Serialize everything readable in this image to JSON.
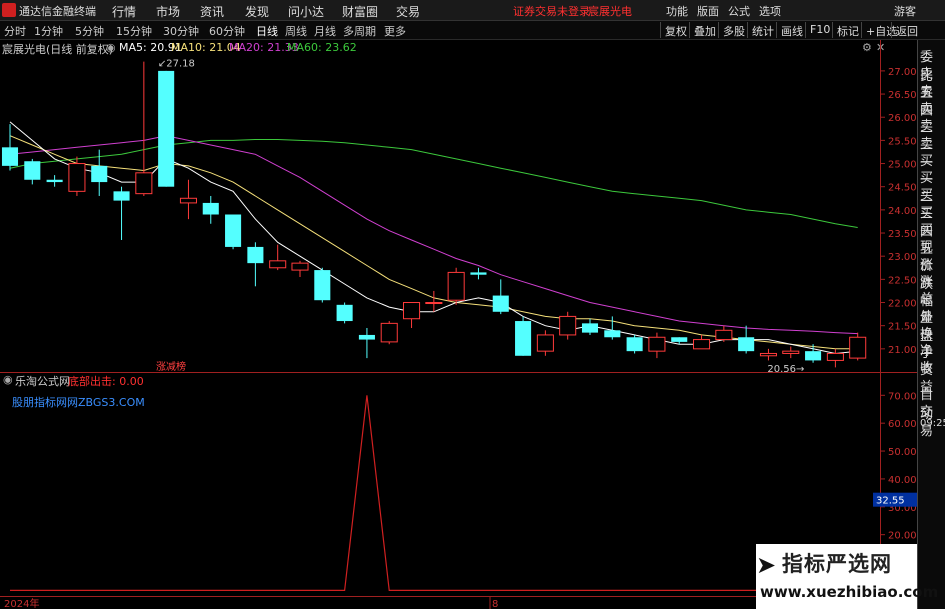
{
  "titlebar": {
    "app_title": "通达信金融终端",
    "menu": [
      "行情",
      "市场",
      "资讯",
      "发现",
      "问小达",
      "财富圈",
      "交易"
    ],
    "notice": "证券交易未登录",
    "stock_name": "宸展光电",
    "right_menu": [
      "功能",
      "版面",
      "公式",
      "选项"
    ],
    "guest": "游客"
  },
  "toolbar": {
    "periods": [
      "分时",
      "1分钟",
      "5分钟",
      "15分钟",
      "30分钟",
      "60分钟",
      "日线",
      "周线",
      "月线",
      "多周期",
      "更多"
    ],
    "active_period": "日线",
    "buttons": [
      "复权",
      "叠加",
      "多股",
      "统计",
      "画线",
      "F10",
      "标记",
      "+自选",
      "返回"
    ]
  },
  "legend": {
    "stock": "宸展光电(日线 前复权)",
    "ma5": "MA5: 20.91",
    "ma10": "MA10: 21.04",
    "ma20": "MA20: 21.33",
    "ma60": "MA60: 23.62"
  },
  "colors": {
    "up": "#ff3b3b",
    "down": "#54ffff",
    "ma5": "#ffffff",
    "ma10": "#f5e07a",
    "ma20": "#d040d0",
    "ma60": "#3cc83c",
    "indicator": "#d02020"
  },
  "price_axis": [
    "27.00",
    "26.50",
    "26.00",
    "25.50",
    "25.00",
    "24.50",
    "24.00",
    "23.50",
    "23.00",
    "22.50",
    "22.00",
    "21.50",
    "21.00"
  ],
  "annotations": {
    "high": "27.18",
    "low": "20.56",
    "tag": "涨减榜"
  },
  "candles": [
    {
      "o": 25.35,
      "c": 24.95,
      "h": 25.85,
      "l": 24.85
    },
    {
      "o": 25.05,
      "c": 24.65,
      "h": 25.1,
      "l": 24.55
    },
    {
      "o": 24.65,
      "c": 24.6,
      "h": 24.75,
      "l": 24.5
    },
    {
      "o": 24.4,
      "c": 25.0,
      "h": 25.15,
      "l": 24.3
    },
    {
      "o": 24.95,
      "c": 24.6,
      "h": 25.3,
      "l": 24.3
    },
    {
      "o": 24.4,
      "c": 24.2,
      "h": 24.5,
      "l": 23.35
    },
    {
      "o": 24.35,
      "c": 24.8,
      "h": 27.2,
      "l": 24.3
    },
    {
      "o": 27.0,
      "c": 24.5,
      "h": 27.0,
      "l": 24.5
    },
    {
      "o": 24.15,
      "c": 24.25,
      "h": 24.65,
      "l": 23.8
    },
    {
      "o": 24.15,
      "c": 23.9,
      "h": 24.3,
      "l": 23.7
    },
    {
      "o": 23.9,
      "c": 23.2,
      "h": 23.9,
      "l": 23.15
    },
    {
      "o": 23.2,
      "c": 22.85,
      "h": 23.3,
      "l": 22.35
    },
    {
      "o": 22.75,
      "c": 22.9,
      "h": 23.25,
      "l": 22.7
    },
    {
      "o": 22.7,
      "c": 22.85,
      "h": 22.9,
      "l": 22.55
    },
    {
      "o": 22.7,
      "c": 22.05,
      "h": 22.75,
      "l": 22.0
    },
    {
      "o": 21.95,
      "c": 21.6,
      "h": 22.0,
      "l": 21.55
    },
    {
      "o": 21.3,
      "c": 21.2,
      "h": 21.45,
      "l": 20.8
    },
    {
      "o": 21.15,
      "c": 21.55,
      "h": 21.6,
      "l": 21.1
    },
    {
      "o": 21.65,
      "c": 22.0,
      "h": 22.0,
      "l": 21.45
    },
    {
      "o": 22.0,
      "c": 22.0,
      "h": 22.25,
      "l": 21.8
    },
    {
      "o": 22.05,
      "c": 22.65,
      "h": 22.75,
      "l": 21.95
    },
    {
      "o": 22.65,
      "c": 22.6,
      "h": 22.75,
      "l": 22.5
    },
    {
      "o": 22.15,
      "c": 21.8,
      "h": 22.5,
      "l": 21.75
    },
    {
      "o": 21.6,
      "c": 20.85,
      "h": 21.7,
      "l": 20.85
    },
    {
      "o": 20.95,
      "c": 21.3,
      "h": 21.4,
      "l": 20.85
    },
    {
      "o": 21.3,
      "c": 21.7,
      "h": 21.8,
      "l": 21.2
    },
    {
      "o": 21.55,
      "c": 21.35,
      "h": 21.65,
      "l": 21.3
    },
    {
      "o": 21.4,
      "c": 21.25,
      "h": 21.7,
      "l": 21.2
    },
    {
      "o": 21.25,
      "c": 20.95,
      "h": 21.3,
      "l": 20.9
    },
    {
      "o": 20.95,
      "c": 21.25,
      "h": 21.35,
      "l": 20.8
    },
    {
      "o": 21.25,
      "c": 21.15,
      "h": 21.25,
      "l": 21.1
    },
    {
      "o": 21.0,
      "c": 21.2,
      "h": 21.3,
      "l": 21.0
    },
    {
      "o": 21.2,
      "c": 21.4,
      "h": 21.5,
      "l": 21.15
    },
    {
      "o": 21.25,
      "c": 20.95,
      "h": 21.5,
      "l": 20.9
    },
    {
      "o": 20.85,
      "c": 20.9,
      "h": 21.0,
      "l": 20.75
    },
    {
      "o": 20.9,
      "c": 20.95,
      "h": 21.05,
      "l": 20.8
    },
    {
      "o": 20.95,
      "c": 20.75,
      "h": 21.1,
      "l": 20.7
    },
    {
      "o": 20.75,
      "c": 20.9,
      "h": 21.0,
      "l": 20.6
    },
    {
      "o": 20.8,
      "c": 21.25,
      "h": 21.35,
      "l": 20.75
    }
  ],
  "ma_lines": {
    "ma5": [
      25.9,
      25.5,
      25.1,
      24.9,
      24.8,
      24.6,
      24.6,
      25.1,
      24.9,
      24.6,
      24.4,
      23.8,
      23.3,
      23.0,
      22.7,
      22.4,
      22.1,
      21.9,
      21.8,
      21.8,
      22.0,
      22.1,
      22.0,
      21.7,
      21.5,
      21.4,
      21.5,
      21.4,
      21.3,
      21.2,
      21.1,
      21.1,
      21.2,
      21.2,
      21.2,
      21.1,
      21.0,
      20.9,
      20.95
    ],
    "ma10": [
      25.6,
      25.4,
      25.2,
      25.0,
      24.95,
      24.9,
      24.85,
      25.0,
      24.95,
      24.8,
      24.6,
      24.3,
      24.0,
      23.7,
      23.4,
      23.1,
      22.8,
      22.5,
      22.3,
      22.1,
      22.0,
      21.95,
      21.9,
      21.8,
      21.7,
      21.65,
      21.65,
      21.6,
      21.5,
      21.45,
      21.4,
      21.3,
      21.25,
      21.2,
      21.15,
      21.1,
      21.05,
      21.0,
      21.0
    ],
    "ma20": [
      25.2,
      25.25,
      25.3,
      25.35,
      25.4,
      25.45,
      25.5,
      25.6,
      25.5,
      25.4,
      25.3,
      25.2,
      24.95,
      24.7,
      24.4,
      24.1,
      23.8,
      23.55,
      23.35,
      23.15,
      22.95,
      22.8,
      22.6,
      22.45,
      22.3,
      22.15,
      22.0,
      21.9,
      21.8,
      21.7,
      21.6,
      21.55,
      21.5,
      21.45,
      21.42,
      21.4,
      21.38,
      21.35,
      21.33
    ],
    "ma60": [
      24.9,
      25.0,
      25.05,
      25.1,
      25.15,
      25.2,
      25.3,
      25.4,
      25.45,
      25.5,
      25.5,
      25.52,
      25.52,
      25.5,
      25.48,
      25.45,
      25.4,
      25.35,
      25.3,
      25.2,
      25.1,
      25.0,
      24.9,
      24.8,
      24.7,
      24.6,
      24.5,
      24.4,
      24.35,
      24.3,
      24.25,
      24.2,
      24.1,
      24.0,
      23.95,
      23.9,
      23.8,
      23.7,
      23.62
    ]
  },
  "sub_panel": {
    "title": "乐淘公式网",
    "signal_label": "底部出击: 0.00",
    "site_label": "股朋指标网网ZBGS3.COM",
    "axis": [
      "70.00",
      "60.00",
      "50.00",
      "40.00",
      "30.00",
      "20.00",
      "10.00"
    ],
    "current_value": "32.55",
    "spike_value": 70,
    "spike_index": 16
  },
  "date_labels": {
    "year": "2024年",
    "month": "8"
  },
  "side_panel": [
    "委比",
    "卖五",
    "卖四",
    "卖三",
    "卖二",
    "卖一",
    "买一",
    "买二",
    "买三",
    "买四",
    "买五",
    "现价",
    "涨跌",
    "涨幅",
    "总量",
    "外盘",
    "换手",
    "净资",
    "收益"
  ],
  "side_panel_bottom": [
    "自动",
    "交易",
    "09:25"
  ],
  "watermark": {
    "line1": "指标严选网",
    "line2": "www.xuezhibiao.com"
  }
}
